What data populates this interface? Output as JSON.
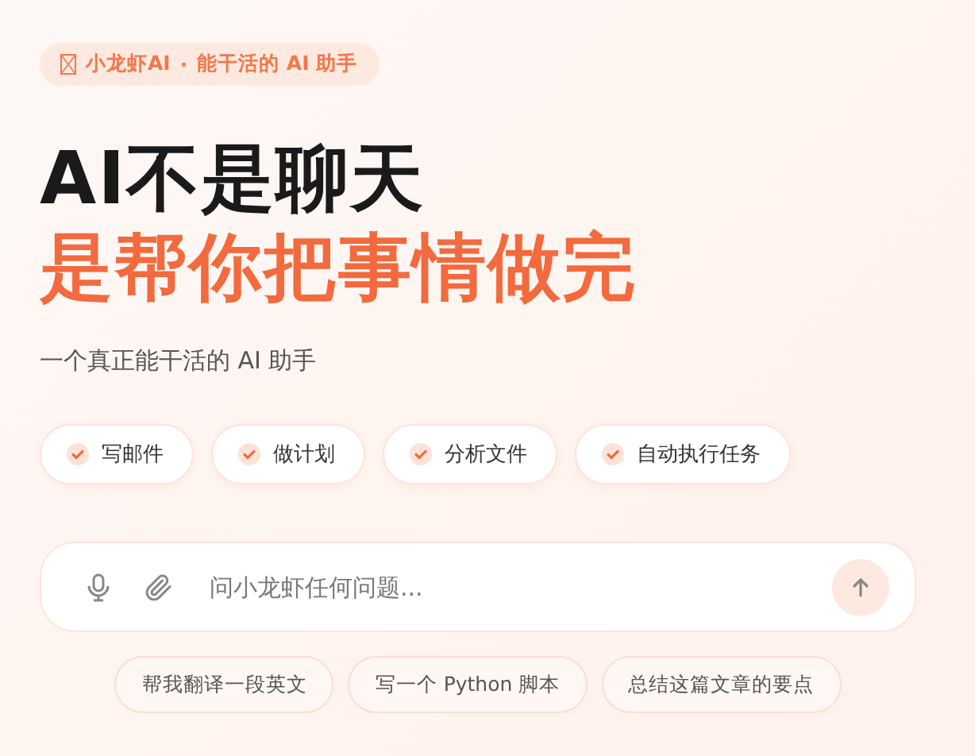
{
  "badge": {
    "brand": "小龙虾AI",
    "separator": "·",
    "tagline": "能干活的 AI 助手"
  },
  "headline": {
    "line_1": "AI不是聊天",
    "line_2": "是帮你把事情做完"
  },
  "subtitle": "一个真正能干活的 AI 助手",
  "features": [
    "写邮件",
    "做计划",
    "分析文件",
    "自动执行任务"
  ],
  "composer": {
    "placeholder": "问小龙虾任何问题..."
  },
  "suggestions": [
    "帮我翻译一段英文",
    "写一个 Python 脚本",
    "总结这篇文章的要点"
  ]
}
